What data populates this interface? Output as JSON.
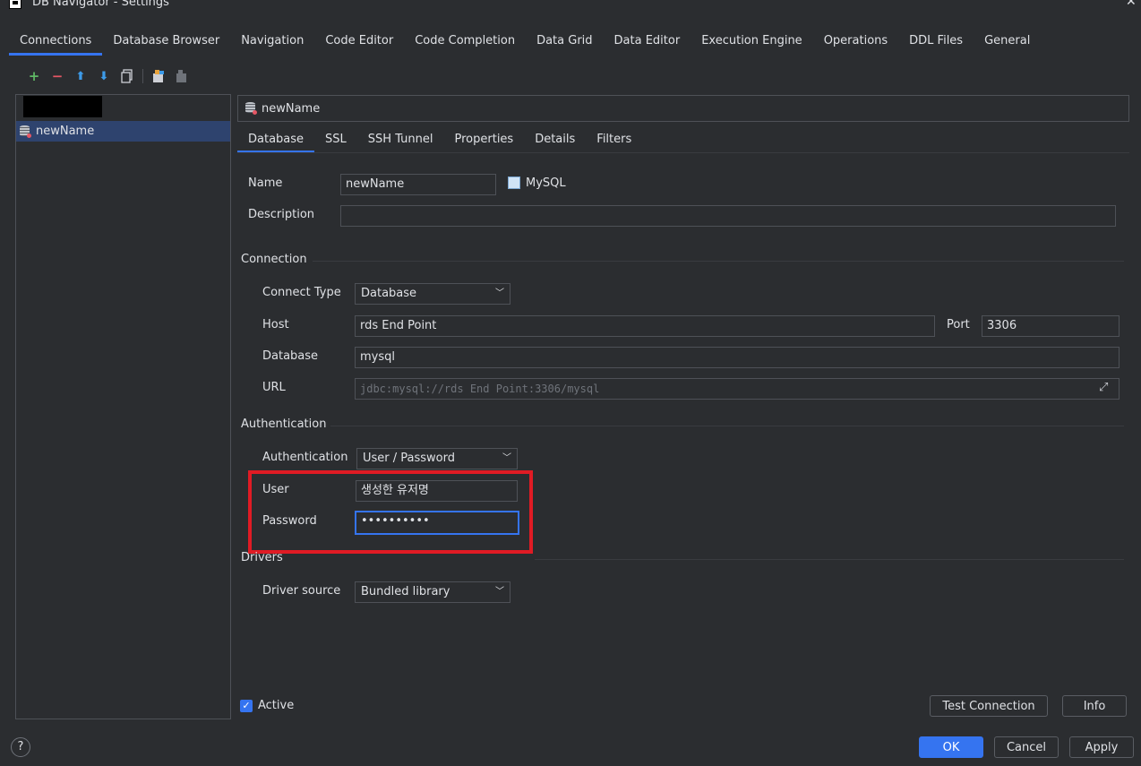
{
  "window": {
    "title": "DB Navigator - Settings"
  },
  "top_tabs": [
    "Connections",
    "Database Browser",
    "Navigation",
    "Code Editor",
    "Code Completion",
    "Data Grid",
    "Data Editor",
    "Execution Engine",
    "Operations",
    "DDL Files",
    "General"
  ],
  "toolbar": {
    "add": "+",
    "remove": "−",
    "up": "⬆",
    "down": "⬇"
  },
  "connections": [
    {
      "label": ""
    },
    {
      "label": "newName"
    }
  ],
  "header": {
    "connection_name": "newName"
  },
  "sub_tabs": [
    "Database",
    "SSL",
    "SSH Tunnel",
    "Properties",
    "Details",
    "Filters"
  ],
  "form": {
    "name_label": "Name",
    "name_value": "newName",
    "db_type": "MySQL",
    "description_label": "Description",
    "description_value": "",
    "connection_section": "Connection",
    "connect_type_label": "Connect Type",
    "connect_type_value": "Database",
    "host_label": "Host",
    "host_value": "rds End Point",
    "port_label": "Port",
    "port_value": "3306",
    "database_label": "Database",
    "database_value": "mysql",
    "url_label": "URL",
    "url_value": "jdbc:mysql://rds End Point:3306/mysql",
    "auth_section": "Authentication",
    "authentication_label": "Authentication",
    "authentication_value": "User / Password",
    "user_label": "User",
    "user_value": "생성한 유저명",
    "password_label": "Password",
    "password_value": "••••••••••",
    "drivers_section": "Drivers",
    "driver_source_label": "Driver source",
    "driver_source_value": "Bundled library"
  },
  "footer": {
    "active_label": "Active",
    "test_connection": "Test Connection",
    "info": "Info",
    "ok": "OK",
    "cancel": "Cancel",
    "apply": "Apply",
    "help": "?"
  },
  "colors": {
    "accent": "#3574f0",
    "highlight_box": "#e01b24",
    "background": "#2b2d30"
  }
}
